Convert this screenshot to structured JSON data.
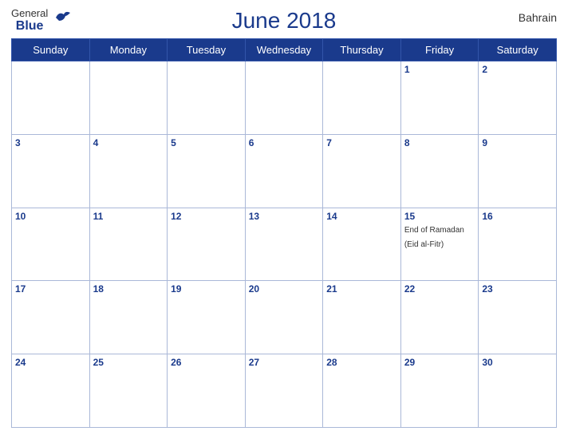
{
  "header": {
    "title": "June 2018",
    "country": "Bahrain",
    "logo_general": "General",
    "logo_blue": "Blue"
  },
  "weekdays": [
    "Sunday",
    "Monday",
    "Tuesday",
    "Wednesday",
    "Thursday",
    "Friday",
    "Saturday"
  ],
  "weeks": [
    [
      {
        "day": "",
        "empty": true
      },
      {
        "day": "",
        "empty": true
      },
      {
        "day": "",
        "empty": true
      },
      {
        "day": "",
        "empty": true
      },
      {
        "day": "",
        "empty": true
      },
      {
        "day": "1",
        "event": ""
      },
      {
        "day": "2",
        "event": ""
      }
    ],
    [
      {
        "day": "3",
        "event": ""
      },
      {
        "day": "4",
        "event": ""
      },
      {
        "day": "5",
        "event": ""
      },
      {
        "day": "6",
        "event": ""
      },
      {
        "day": "7",
        "event": ""
      },
      {
        "day": "8",
        "event": ""
      },
      {
        "day": "9",
        "event": ""
      }
    ],
    [
      {
        "day": "10",
        "event": ""
      },
      {
        "day": "11",
        "event": ""
      },
      {
        "day": "12",
        "event": ""
      },
      {
        "day": "13",
        "event": ""
      },
      {
        "day": "14",
        "event": ""
      },
      {
        "day": "15",
        "event": "End of Ramadan (Eid al-Fitr)"
      },
      {
        "day": "16",
        "event": ""
      }
    ],
    [
      {
        "day": "17",
        "event": ""
      },
      {
        "day": "18",
        "event": ""
      },
      {
        "day": "19",
        "event": ""
      },
      {
        "day": "20",
        "event": ""
      },
      {
        "day": "21",
        "event": ""
      },
      {
        "day": "22",
        "event": ""
      },
      {
        "day": "23",
        "event": ""
      }
    ],
    [
      {
        "day": "24",
        "event": ""
      },
      {
        "day": "25",
        "event": ""
      },
      {
        "day": "26",
        "event": ""
      },
      {
        "day": "27",
        "event": ""
      },
      {
        "day": "28",
        "event": ""
      },
      {
        "day": "29",
        "event": ""
      },
      {
        "day": "30",
        "event": ""
      }
    ]
  ]
}
